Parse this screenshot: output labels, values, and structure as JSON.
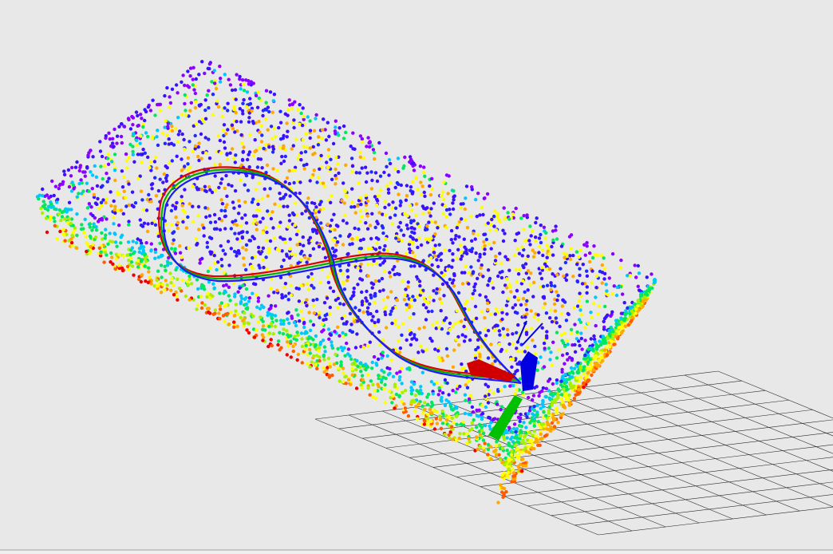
{
  "viewer": {
    "background": "#E8E8E8",
    "grid_color": "#2A2A2A",
    "colormap": [
      "#8B00FF",
      "#3A10FF",
      "#1E2BFF",
      "#00C8FF",
      "#00E860",
      "#A8F000",
      "#FFFF00",
      "#FFA800",
      "#FF5A00",
      "#F00000"
    ]
  },
  "trajectories": [
    {
      "name": "trajectory-red",
      "color": "#E00000"
    },
    {
      "name": "trajectory-green",
      "color": "#00B000"
    },
    {
      "name": "trajectory-blue",
      "color": "#1A1AFF"
    }
  ],
  "axes_marker": {
    "x_color": "#D00000",
    "y_color": "#00C000",
    "z_color": "#0000E0"
  },
  "status_bar": {
    "color": "#F0F0F0",
    "border": "#A0A0A0"
  }
}
